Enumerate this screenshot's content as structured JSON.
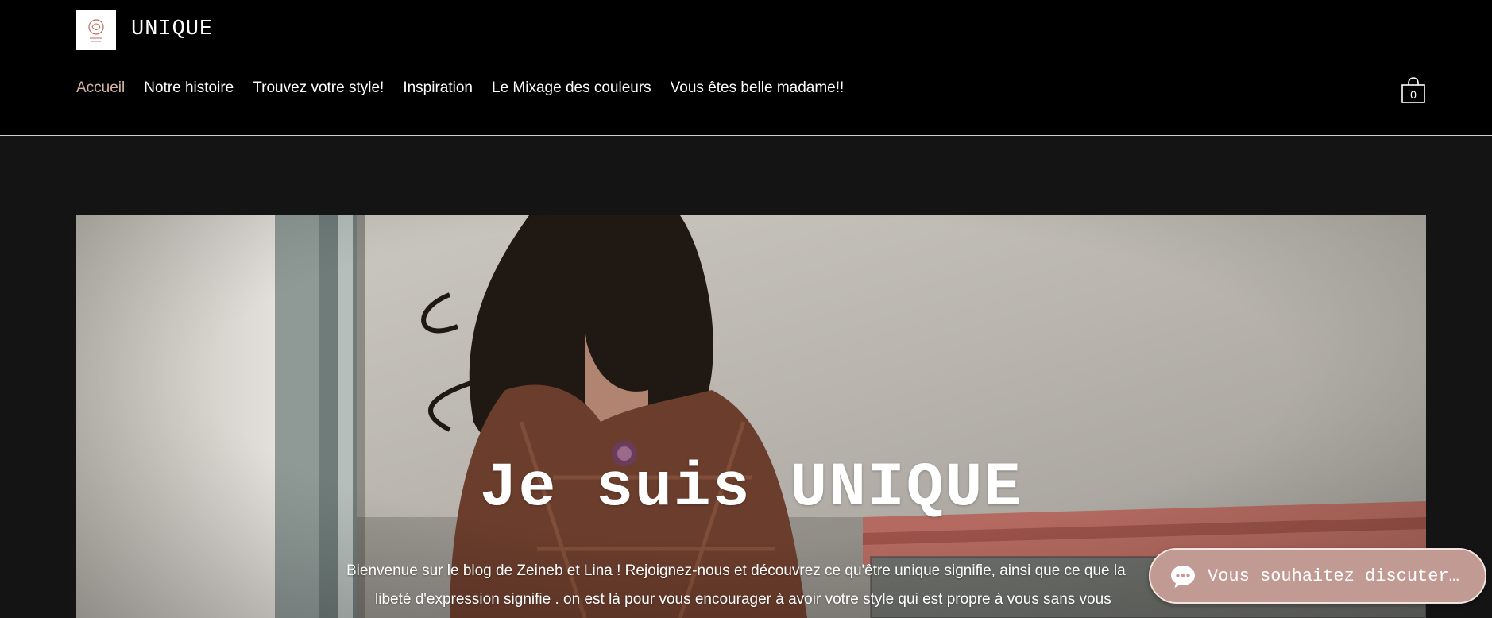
{
  "header": {
    "site_title": "UNIQUE",
    "nav": [
      {
        "label": "Accueil",
        "active": true
      },
      {
        "label": "Notre histoire",
        "active": false
      },
      {
        "label": "Trouvez votre style!",
        "active": false
      },
      {
        "label": "Inspiration",
        "active": false
      },
      {
        "label": "Le Mixage des couleurs",
        "active": false
      },
      {
        "label": "Vous êtes belle madame!!",
        "active": false
      }
    ],
    "cart_count": "0"
  },
  "hero": {
    "title": "Je suis UNIQUE",
    "text_line1": "Bienvenue sur le blog de Zeineb et Lina ! Rejoignez-nous et découvrez ce qu'être unique signifie, ainsi que ce que la",
    "text_line2": "libeté d'expression signifie . on est là pour vous encourager à avoir votre style qui est propre à vous sans vous"
  },
  "chat": {
    "label": "Vous souhaitez discuter…"
  },
  "colors": {
    "header_bg": "#000000",
    "page_bg": "#141414",
    "active_nav": "#d7b5a6",
    "chat_bg": "#c19a94"
  },
  "icons": {
    "logo": "brand-logo-icon",
    "cart": "shopping-bag-icon",
    "chat": "chat-bubble-icon"
  }
}
